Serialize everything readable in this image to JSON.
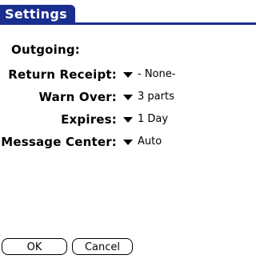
{
  "window": {
    "title": "Settings"
  },
  "section": {
    "heading": "Outgoing:"
  },
  "settings": [
    {
      "label": "Return Receipt:",
      "value": "- None-"
    },
    {
      "label": "Warn Over:",
      "value": "3 parts"
    },
    {
      "label": "Expires:",
      "value": "1 Day"
    },
    {
      "label": "Message Center:",
      "value": "Auto"
    }
  ],
  "buttons": {
    "ok_label": "OK",
    "cancel_label": "Cancel"
  },
  "icons": {
    "dropdown": "chevron-down-icon"
  },
  "colors": {
    "titlebar": "#1a2e8f",
    "background": "#ffffff"
  }
}
